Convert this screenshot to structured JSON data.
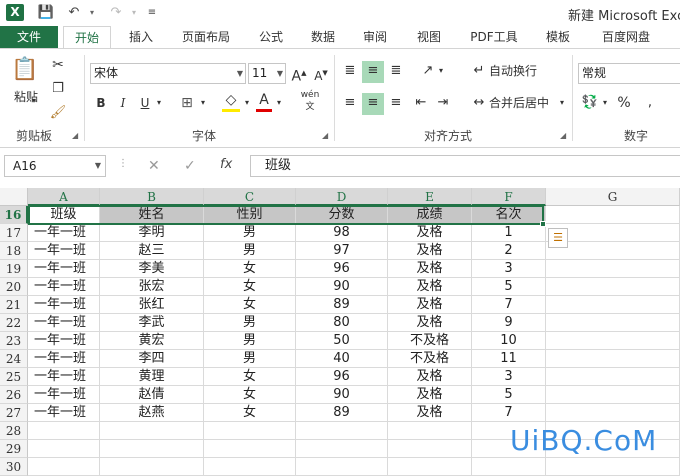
{
  "app": {
    "logo": "X",
    "title": "新建 Microsoft Exce",
    "qa_icons": [
      "save-icon",
      "undo-icon",
      "redo-icon",
      "customize-icon"
    ]
  },
  "tabs": [
    "文件",
    "开始",
    "插入",
    "页面布局",
    "公式",
    "数据",
    "审阅",
    "视图",
    "PDF工具",
    "模板",
    "百度网盘"
  ],
  "active_tab": "开始",
  "ribbon": {
    "clipboard": {
      "label": "剪贴板",
      "paste": "粘贴"
    },
    "font": {
      "label": "字体",
      "name": "宋体",
      "size": "11",
      "bold": "B",
      "italic": "I",
      "underline": "U",
      "wen": "wén"
    },
    "alignment": {
      "label": "对齐方式",
      "wrap": "自动换行",
      "merge": "合并后居中"
    },
    "number": {
      "label": "数字",
      "format": "常规",
      "percent": "%"
    }
  },
  "formula_bar": {
    "name_box": "A16",
    "fx": "fx",
    "content": "班级"
  },
  "columns": [
    "A",
    "B",
    "C",
    "D",
    "E",
    "F",
    "G"
  ],
  "selected_row": "16",
  "rows": [
    {
      "num": "16",
      "cells": [
        "班级",
        "姓名",
        "性别",
        "分数",
        "成绩",
        "名次"
      ]
    },
    {
      "num": "17",
      "cells": [
        "一年一班",
        "李明",
        "男",
        "98",
        "及格",
        "1"
      ]
    },
    {
      "num": "18",
      "cells": [
        "一年一班",
        "赵三",
        "男",
        "97",
        "及格",
        "2"
      ]
    },
    {
      "num": "19",
      "cells": [
        "一年一班",
        "李美",
        "女",
        "96",
        "及格",
        "3"
      ]
    },
    {
      "num": "20",
      "cells": [
        "一年一班",
        "张宏",
        "女",
        "90",
        "及格",
        "5"
      ]
    },
    {
      "num": "21",
      "cells": [
        "一年一班",
        "张红",
        "女",
        "89",
        "及格",
        "7"
      ]
    },
    {
      "num": "22",
      "cells": [
        "一年一班",
        "李武",
        "男",
        "80",
        "及格",
        "9"
      ]
    },
    {
      "num": "23",
      "cells": [
        "一年一班",
        "黄宏",
        "男",
        "50",
        "不及格",
        "10"
      ]
    },
    {
      "num": "24",
      "cells": [
        "一年一班",
        "李四",
        "男",
        "40",
        "不及格",
        "11"
      ]
    },
    {
      "num": "25",
      "cells": [
        "一年一班",
        "黄理",
        "女",
        "96",
        "及格",
        "3"
      ]
    },
    {
      "num": "26",
      "cells": [
        "一年一班",
        "赵倩",
        "女",
        "90",
        "及格",
        "5"
      ]
    },
    {
      "num": "27",
      "cells": [
        "一年一班",
        "赵燕",
        "女",
        "89",
        "及格",
        "7"
      ]
    },
    {
      "num": "28",
      "cells": [
        "",
        "",
        "",
        "",
        "",
        ""
      ]
    },
    {
      "num": "29",
      "cells": [
        "",
        "",
        "",
        "",
        "",
        ""
      ]
    },
    {
      "num": "30",
      "cells": [
        "",
        "",
        "",
        "",
        "",
        ""
      ]
    }
  ],
  "watermark": "UiBQ.CoM",
  "colors": {
    "accent": "#217346",
    "header_selected": "#c6c6c6",
    "watermark": "#3a8de0"
  }
}
